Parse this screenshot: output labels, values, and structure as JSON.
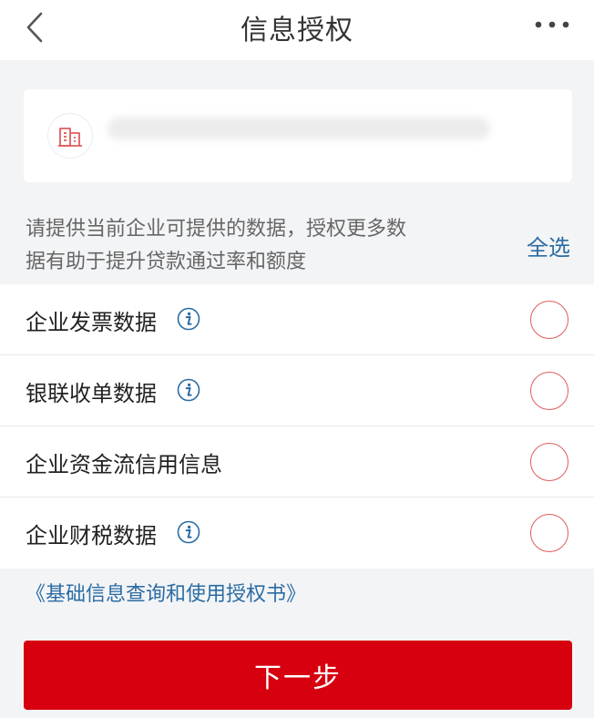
{
  "header": {
    "back_icon": "chevron-left-icon",
    "title": "信息授权",
    "more_icon": "more-horizontal-icon"
  },
  "company": {
    "icon": "building-icon",
    "accent": "#e05c5c"
  },
  "intro": {
    "line1": "请提供当前企业可提供的数据，授权更多数",
    "line2": "据有助于提升贷款通过率和额度",
    "select_all": "全选"
  },
  "items": [
    {
      "label": "企业发票数据",
      "has_info": true,
      "selected": false
    },
    {
      "label": "银联收单数据",
      "has_info": true,
      "selected": false
    },
    {
      "label": "企业资金流信用信息",
      "has_info": false,
      "selected": false
    },
    {
      "label": "企业财税数据",
      "has_info": true,
      "selected": false
    }
  ],
  "agreement_link": "《基础信息查询和使用授权书》",
  "next_button": "下一步",
  "colors": {
    "primary_button": "#d6000f",
    "link": "#2b6ca3",
    "radio_border": "#e05c5c",
    "background": "#f3f4f6"
  }
}
